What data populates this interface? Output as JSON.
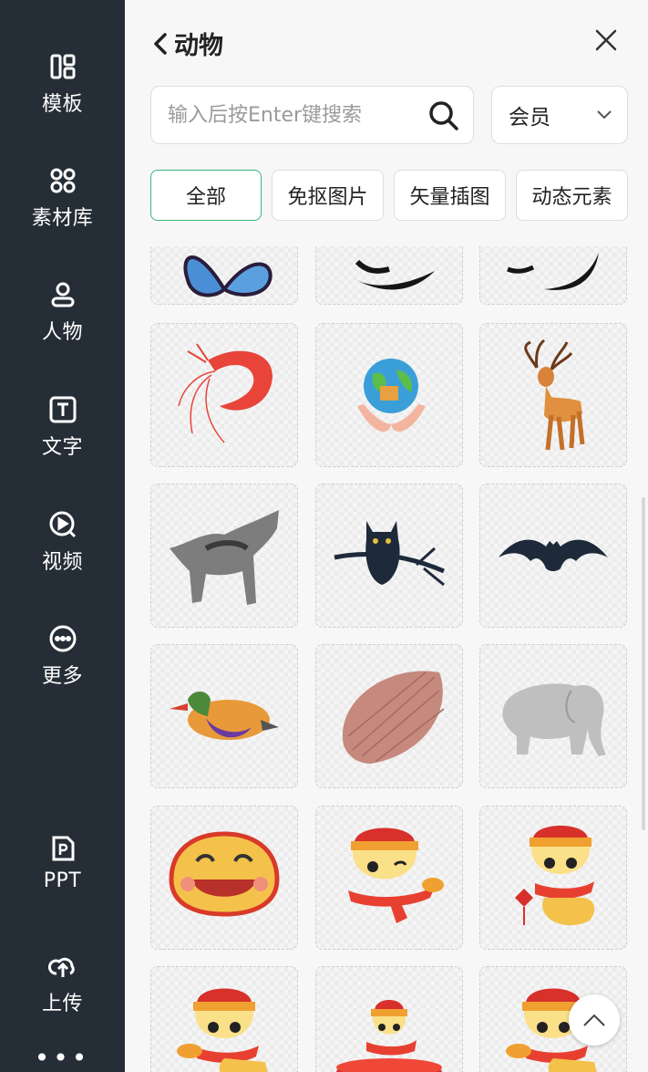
{
  "sidebar": {
    "items": [
      {
        "label": "模板",
        "icon": "template-icon"
      },
      {
        "label": "素材库",
        "icon": "material-library-icon"
      },
      {
        "label": "人物",
        "icon": "person-icon"
      },
      {
        "label": "文字",
        "icon": "text-icon"
      },
      {
        "label": "视频",
        "icon": "video-icon"
      },
      {
        "label": "更多",
        "icon": "more-icon"
      },
      {
        "label": "PPT",
        "icon": "ppt-icon"
      },
      {
        "label": "上传",
        "icon": "upload-icon"
      }
    ],
    "overflow": "•••"
  },
  "header": {
    "title": "动物",
    "back_icon": "chevron-left-icon",
    "close_icon": "close-icon"
  },
  "search": {
    "placeholder": "输入后按Enter键搜索",
    "value": "",
    "icon": "search-icon"
  },
  "filter": {
    "selected": "会员",
    "icon": "chevron-down-icon"
  },
  "tabs": [
    {
      "label": "全部",
      "active": true
    },
    {
      "label": "免抠图片",
      "active": false
    },
    {
      "label": "矢量插图",
      "active": false
    },
    {
      "label": "动态元素",
      "active": false
    }
  ],
  "grid": {
    "items": [
      "butterfly",
      "swallow",
      "swallow",
      "shrimp",
      "earth-in-hands",
      "deer",
      "wolf",
      "owl",
      "bat",
      "mandarin-duck",
      "shell",
      "elephant",
      "cartoon-snake-face",
      "cartoon-snake-waving",
      "cartoon-snake-lantern",
      "cartoon-snake",
      "cartoon-snake-drum",
      "cartoon-snake"
    ]
  },
  "colors": {
    "sidebar": "#252d36",
    "accent": "#3cb37a",
    "panel": "#f7f7f7"
  },
  "back_to_top_icon": "chevron-up-icon"
}
